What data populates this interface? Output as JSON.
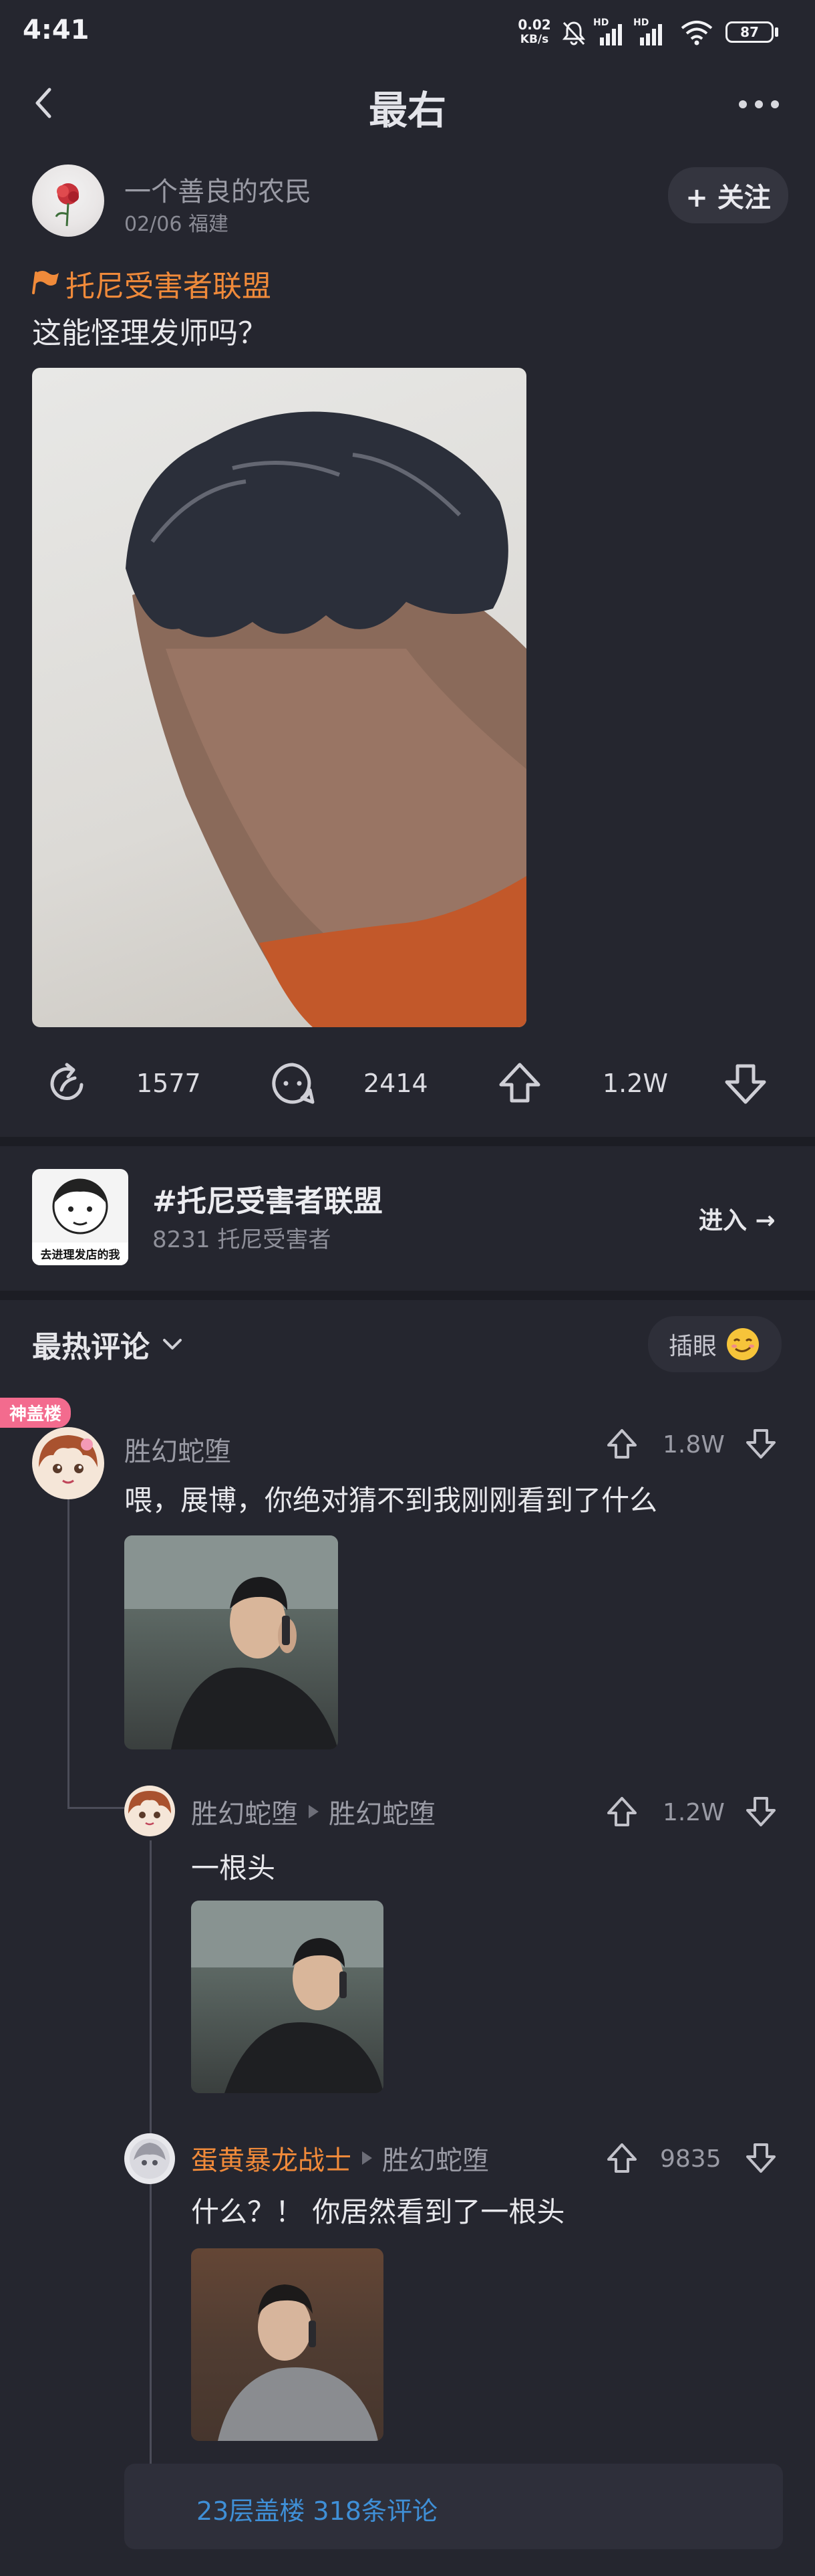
{
  "status_bar": {
    "time": "4:41",
    "net_speed_top": "0.02",
    "net_speed_unit": "KB/s",
    "hd1": "HD",
    "hd2": "HD",
    "battery": "87"
  },
  "header": {
    "title": "最右"
  },
  "post": {
    "author": "一个善良的农民",
    "meta": "02/06 福建",
    "follow_label": "+ 关注",
    "topic_tag": "托尼受害者联盟",
    "text": "这能怪理发师吗？",
    "actions": {
      "share_count": "1577",
      "comment_count": "2414",
      "like_count": "1.2W"
    }
  },
  "topic_card": {
    "title": "#托尼受害者联盟",
    "subtitle": "8231 托尼受害者",
    "enter_label": "进入 →",
    "thumb_text": "去进理发店的我"
  },
  "comments_section": {
    "sort_label": "最热评论",
    "insert_label": "插眼"
  },
  "comments": [
    {
      "badge": "神盖楼",
      "username": "胜幻蛇堕",
      "votes": "1.8W",
      "text": "喂，展博，你绝对猜不到我刚刚看到了什么"
    }
  ],
  "replies": [
    {
      "username": "胜幻蛇堕",
      "reply_to": "胜幻蛇堕",
      "votes": "1.2W",
      "text": "一根头"
    },
    {
      "username": "蛋黄暴龙战士",
      "reply_to": "胜幻蛇堕",
      "votes": "9835",
      "text": "什么？！ 你居然看到了一根头"
    }
  ],
  "thread_summary": {
    "label": "23层盖楼 318条评论"
  },
  "colors": {
    "background": "#25262f",
    "accent_orange": "#f08a3a",
    "link_blue": "#3f8fd6",
    "badge_pink": "#f36b8e"
  }
}
